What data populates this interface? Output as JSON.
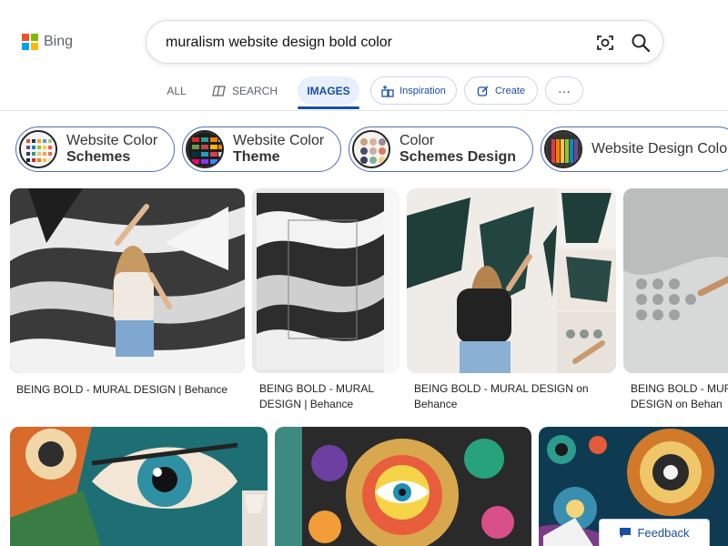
{
  "app": {
    "brand": "Bing",
    "brand_colors": [
      "#f25022",
      "#7fba00",
      "#00a4ef",
      "#ffb900"
    ]
  },
  "search": {
    "query": "muralism website design bold color"
  },
  "tabs": [
    {
      "label": "ALL"
    },
    {
      "label": "SEARCH",
      "icon": "copilot-icon"
    },
    {
      "label": "IMAGES",
      "selected": true
    },
    {
      "label": "Inspiration",
      "icon": "inspiration-icon"
    },
    {
      "label": "Create",
      "icon": "create-icon"
    },
    {
      "label": "···"
    }
  ],
  "chips": [
    {
      "line1": "Website Color",
      "line2": "Schemes"
    },
    {
      "line1": "Website Color",
      "line2": "Theme"
    },
    {
      "line1": "Color",
      "line2": "Schemes Design"
    },
    {
      "line1": "Website Design Color"
    }
  ],
  "results": [
    {
      "caption": "BEING BOLD - MURAL DESIGN | Behance"
    },
    {
      "caption_line1": "BEING BOLD - MURAL",
      "caption_line2": "DESIGN | Behance"
    },
    {
      "caption_line1": "BEING BOLD - MURAL DESIGN on",
      "caption_line2": "Behance"
    },
    {
      "caption_line1": "BEING BOLD - MUR",
      "caption_line2": "DESIGN on Behan"
    }
  ],
  "feedback": {
    "label": "Feedback"
  },
  "colors": {
    "accent": "#174ea6",
    "selected_tab_bg": "#e8efff",
    "chip_border": "#4a6fb5"
  }
}
